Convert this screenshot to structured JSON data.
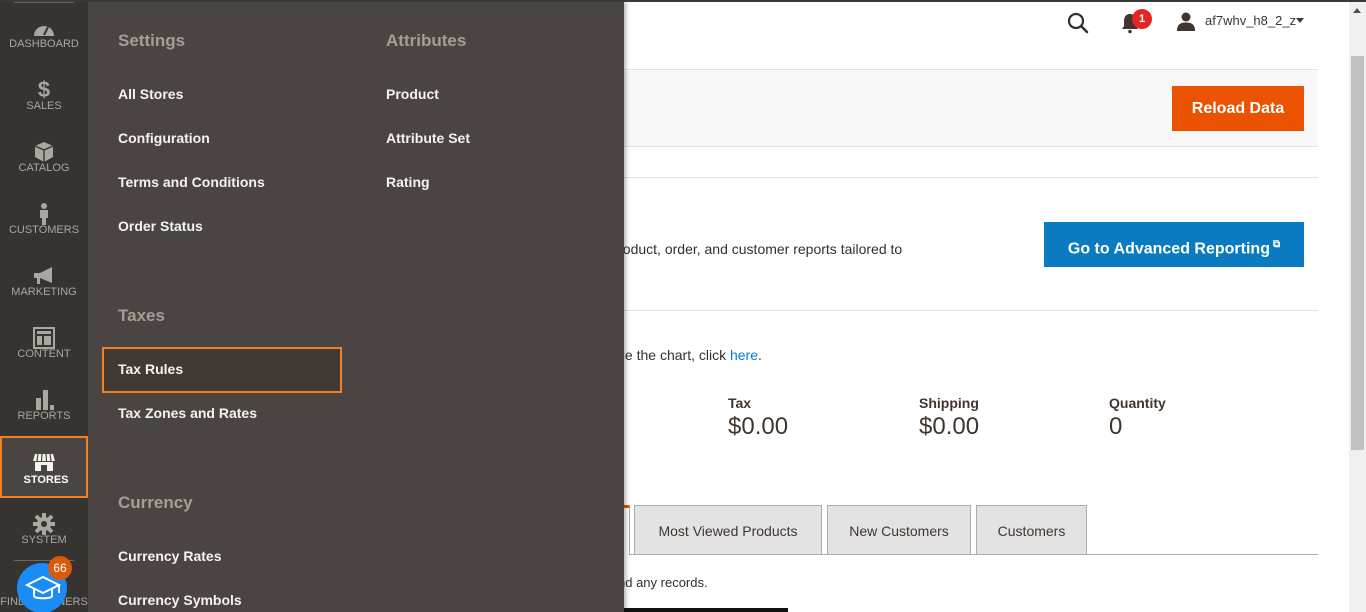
{
  "header": {
    "user_name": "af7whv_h8_2_z",
    "notification_count": "1",
    "icons": {
      "search": "search-icon",
      "notifications": "bell-icon",
      "user": "user-icon"
    }
  },
  "action_bar": {
    "reload_label": "Reload Data"
  },
  "advanced_reporting": {
    "text": "ur dynamic product, order, and customer reports tailored to",
    "button_label": "Go to Advanced Reporting",
    "button_icon": "external-link-icon"
  },
  "chart_note": {
    "text": "bled. To enable the chart, click ",
    "link_label": "here",
    "suffix": "."
  },
  "totals": [
    {
      "label": "Tax",
      "value": "$0.00"
    },
    {
      "label": "Shipping",
      "value": "$0.00"
    },
    {
      "label": "Quantity",
      "value": "0"
    }
  ],
  "tabs": [
    {
      "label": "Most Viewed Products"
    },
    {
      "label": "New Customers"
    },
    {
      "label": "Customers"
    }
  ],
  "no_records_text": "nd any records.",
  "nav": {
    "items": [
      {
        "label": "DASHBOARD",
        "icon": "dashboard-icon"
      },
      {
        "label": "SALES",
        "icon": "dollar-icon"
      },
      {
        "label": "CATALOG",
        "icon": "box-icon"
      },
      {
        "label": "CUSTOMERS",
        "icon": "person-icon"
      },
      {
        "label": "MARKETING",
        "icon": "megaphone-icon"
      },
      {
        "label": "CONTENT",
        "icon": "layout-icon"
      },
      {
        "label": "REPORTS",
        "icon": "bar-chart-icon"
      },
      {
        "label": "STORES",
        "icon": "storefront-icon",
        "active": true
      },
      {
        "label": "SYSTEM",
        "icon": "gear-icon"
      },
      {
        "label": "FIND PARTNERS",
        "icon": "partners-icon"
      }
    ],
    "partners_badge": "66"
  },
  "flyout": {
    "sections": [
      {
        "title": "Settings",
        "items": [
          "All Stores",
          "Configuration",
          "Terms and Conditions",
          "Order Status"
        ]
      },
      {
        "title": "Attributes",
        "items": [
          "Product",
          "Attribute Set",
          "Rating"
        ]
      },
      {
        "title": "Taxes",
        "items": [
          "Tax Rules",
          "Tax Zones and Rates"
        ]
      },
      {
        "title": "Currency",
        "items": [
          "Currency Rates",
          "Currency Symbols"
        ]
      }
    ],
    "selected_item": "Tax Rules"
  },
  "colors": {
    "accent_orange": "#eb5202",
    "highlight_orange": "#f0811e",
    "reporting_blue": "#0a7bc1",
    "nav_bg": "#373330",
    "flyout_bg": "#4a4542",
    "badge_red": "#e22626"
  }
}
